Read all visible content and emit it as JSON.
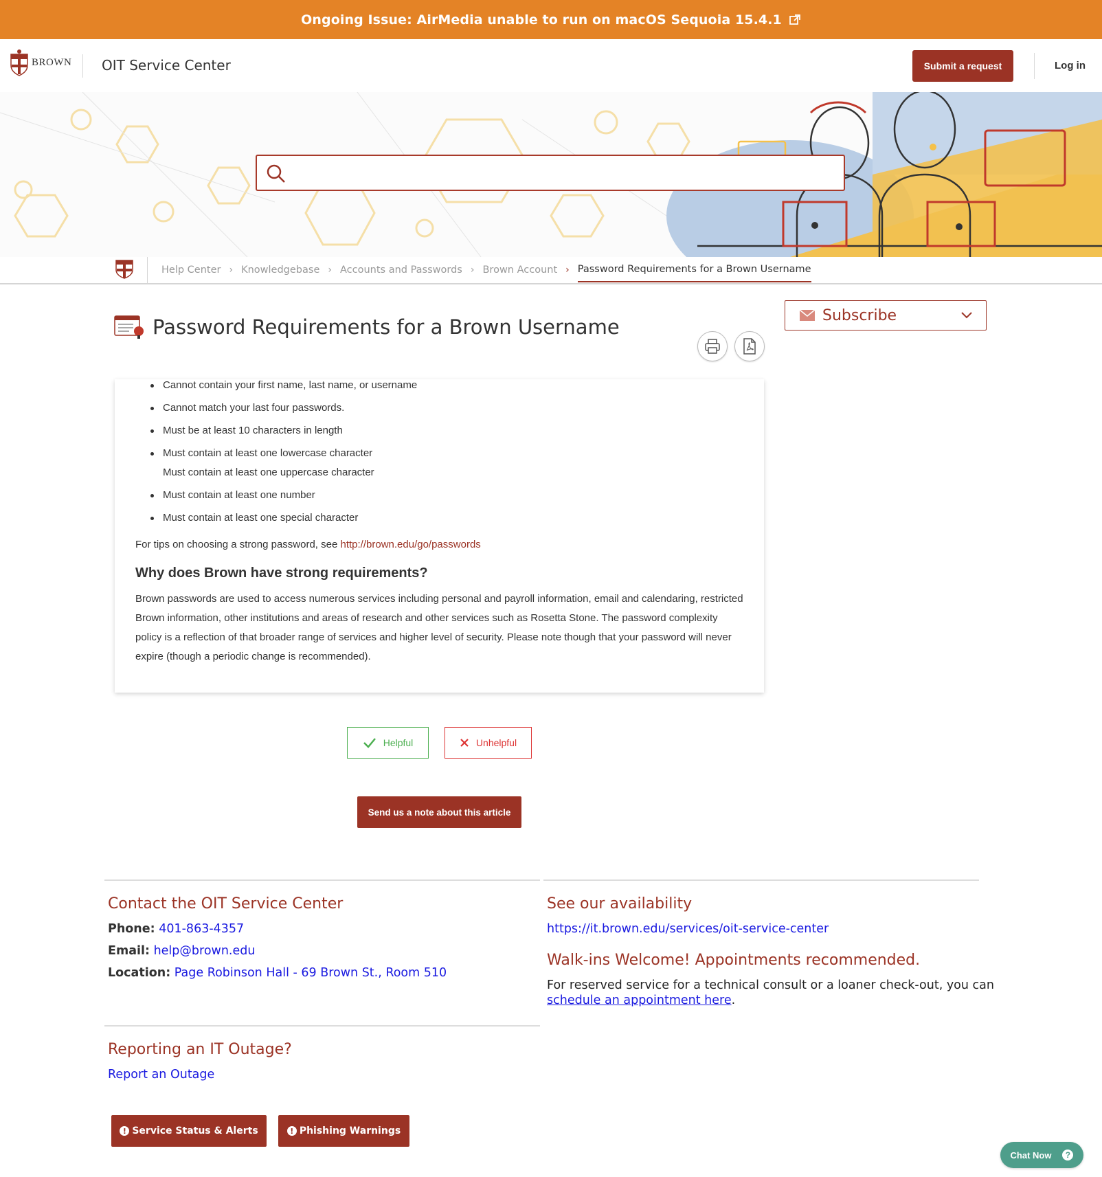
{
  "alert": {
    "text": "Ongoing Issue: AirMedia unable to run on macOS Sequoia 15.4.1",
    "icon": "external-link-icon"
  },
  "header": {
    "logo_text": "BROWN",
    "site_title": "OIT Service Center",
    "submit_label": "Submit a request",
    "login_label": "Log in"
  },
  "search": {
    "placeholder": ""
  },
  "breadcrumb": {
    "items": [
      "Help Center",
      "Knowledgebase",
      "Accounts and Passwords",
      "Brown Account"
    ],
    "current": "Password Requirements for a Brown Username"
  },
  "article": {
    "title": "Password Requirements for a Brown Username",
    "subscribe_label": "Subscribe",
    "requirements": [
      "Cannot contain your first name, last name, or username",
      "Cannot match your last four passwords.",
      "Must be at least 10 characters in length",
      "Must contain at least one lowercase character",
      "Must contain at least one uppercase character",
      "Must contain at least one number",
      "Must contain at least one special character"
    ],
    "tips_prefix": "For tips on choosing a strong password, see ",
    "tips_link": "http://brown.edu/go/passwords",
    "why_heading": "Why does Brown have strong requirements?",
    "why_body": "Brown passwords are used to access numerous services including personal and payroll information, email and calendaring, restricted Brown information, other institutions and areas of research and other services such as Rosetta Stone.  The password complexity policy is a reflection of that broader range of services and higher level of security.  Please note though that your password will never expire (though a periodic change is recommended)."
  },
  "feedback": {
    "helpful_label": "Helpful",
    "unhelpful_label": "Unhelpful",
    "note_label": "Send us a note about this article"
  },
  "footer": {
    "contact_heading": "Contact the OIT Service Center",
    "phone_label": "Phone:",
    "phone_value": "401-863-4357",
    "email_label": "Email:",
    "email_value": "help@brown.edu",
    "location_label": "Location:",
    "location_value": "Page Robinson Hall - 69 Brown St., Room 510",
    "availability_heading": "See our availability",
    "availability_link": "https://it.brown.edu/services/oit-service-center",
    "walkins_heading": "Walk-ins Welcome! Appointments recommended.",
    "walkins_text": "For reserved service for a technical consult or a loaner check-out, you can",
    "appointment_link": "schedule an appointment here",
    "outage_heading": "Reporting an IT Outage?",
    "outage_link": "Report an Outage",
    "status_button": "Service Status & Alerts",
    "phishing_button": "Phishing Warnings"
  },
  "chat": {
    "label": "Chat Now"
  },
  "colors": {
    "alert_bg": "#e48326",
    "brand_red": "#9b3325",
    "helpful_green": "#4caf50",
    "unhelpful_red": "#dd3333",
    "link_blue": "#1a1ae0",
    "chat_teal": "#4e9e8b"
  }
}
